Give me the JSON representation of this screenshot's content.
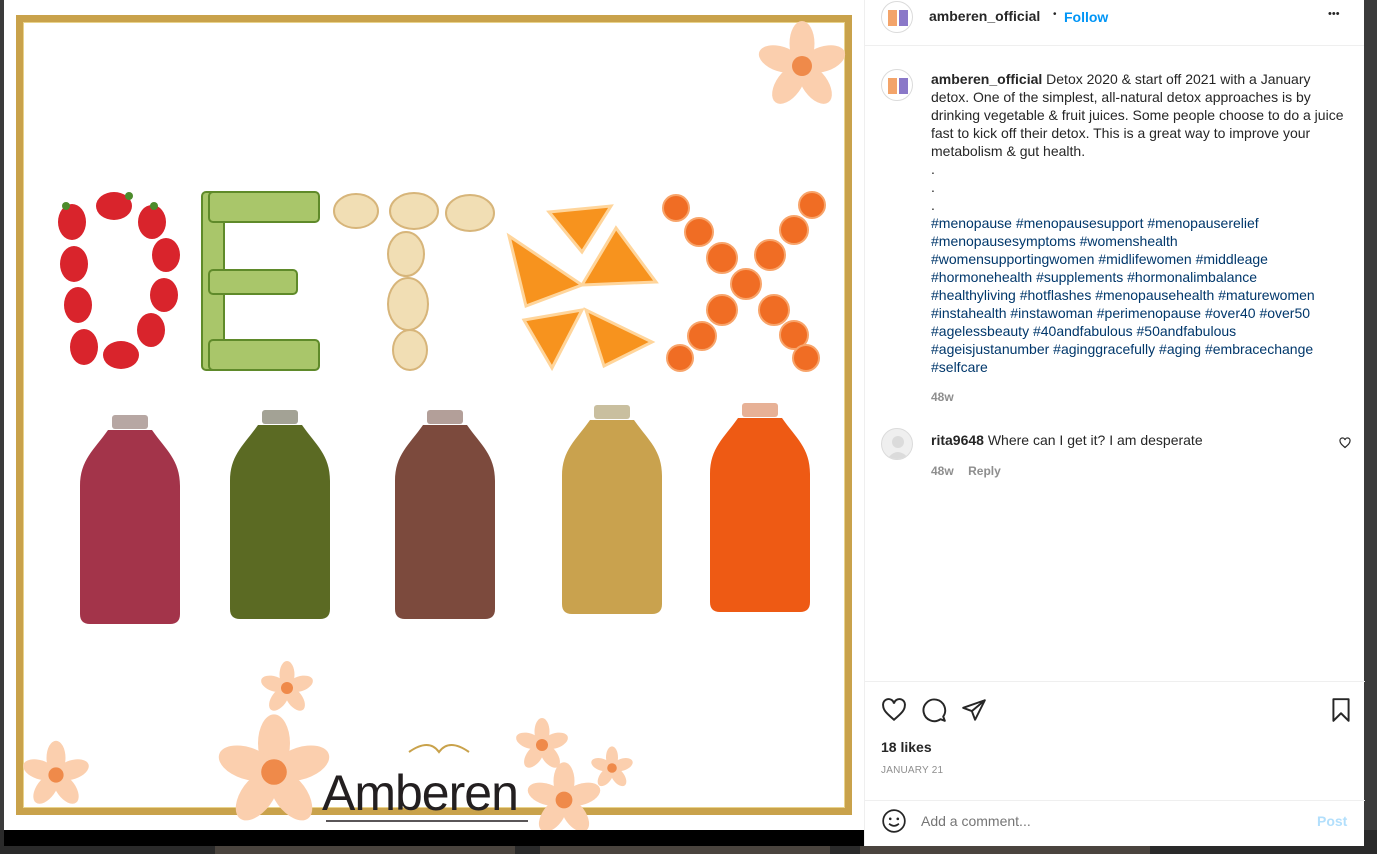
{
  "post": {
    "username": "amberen_official",
    "separator": "•",
    "follow_label": "Follow",
    "more_label": "•••"
  },
  "media": {
    "letters": [
      "D",
      "E",
      "T",
      "O",
      "X"
    ],
    "brand_logo_text": "Amberen",
    "bottle_colors": [
      "#a3344a",
      "#5b6a23",
      "#7c4a3d",
      "#c9a24e",
      "#ee5a14"
    ],
    "frame_color": "#c9a24b"
  },
  "caption": {
    "username": "amberen_official",
    "text": "Detox 2020 & start off 2021 with a January detox. One of the simplest, all-natural detox approaches is by drinking vegetable & fruit juices. Some people choose to do a juice fast to kick off their detox. This is a great way to improve your metabolism & gut health.",
    "dots": [
      ".",
      ".",
      "."
    ],
    "hashtags_lines": [
      "#menopause #menopausesupport #menopauserelief",
      "#menopausesymptoms #womenshealth",
      "#womensupportingwomen #midlifewomen #middleage",
      "#hormonehealth #supplements #hormonalimbalance",
      "#healthyliving #hotflashes #menopausehealth #maturewomen",
      "#instahealth #instawoman #perimenopause #over40 #over50",
      "#agelessbeauty #40andfabulous #50andfabulous",
      "#ageisjustanumber #aginggracefully #aging #embracechange",
      "#selfcare"
    ],
    "age": "48w"
  },
  "comment": {
    "username": "rita9648",
    "text": "Where can I get it? I am desperate",
    "age": "48w",
    "reply_label": "Reply"
  },
  "stats": {
    "likes": "18 likes",
    "date": "JANUARY 21"
  },
  "add_comment": {
    "placeholder": "Add a comment...",
    "post_label": "Post"
  },
  "colors": {
    "link_blue": "#0095f6",
    "hashtag_blue": "#00376b",
    "muted": "#8e8e8e",
    "post_disabled": "#b2dffc"
  }
}
